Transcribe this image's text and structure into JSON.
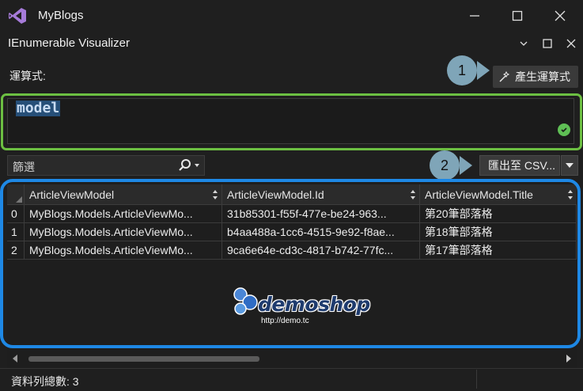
{
  "window": {
    "title": "MyBlogs"
  },
  "visualizer": {
    "title": "IEnumerable Visualizer"
  },
  "expression": {
    "label": "運算式:",
    "value": "model",
    "generate_button": "產生運算式",
    "callout_1": "1"
  },
  "filter": {
    "placeholder": "篩選"
  },
  "export": {
    "button": "匯出至 CSV...",
    "callout_2": "2"
  },
  "grid": {
    "columns": [
      "ArticleViewModel",
      "ArticleViewModel.Id",
      "ArticleViewModel.Title"
    ],
    "rows": [
      {
        "index": "0",
        "cells": [
          "MyBlogs.Models.ArticleViewMo...",
          "31b85301-f55f-477e-be24-963...",
          "第20筆部落格"
        ]
      },
      {
        "index": "1",
        "cells": [
          "MyBlogs.Models.ArticleViewMo...",
          "b4aa488a-1cc6-4515-9e92-f8ae...",
          "第18筆部落格"
        ]
      },
      {
        "index": "2",
        "cells": [
          "MyBlogs.Models.ArticleViewMo...",
          "9ca6e64e-cd3c-4817-b742-77fc...",
          "第17筆部落格"
        ]
      }
    ]
  },
  "watermark": {
    "brand": "demoshop",
    "url": "http://demo.tc"
  },
  "status": {
    "row_count_text": "資料列總數: 3"
  },
  "colors": {
    "expression_highlight": "#6cbf42",
    "grid_highlight": "#1e88e5",
    "callout": "#7fa5b8",
    "accent_purple": "#a67bd9"
  }
}
